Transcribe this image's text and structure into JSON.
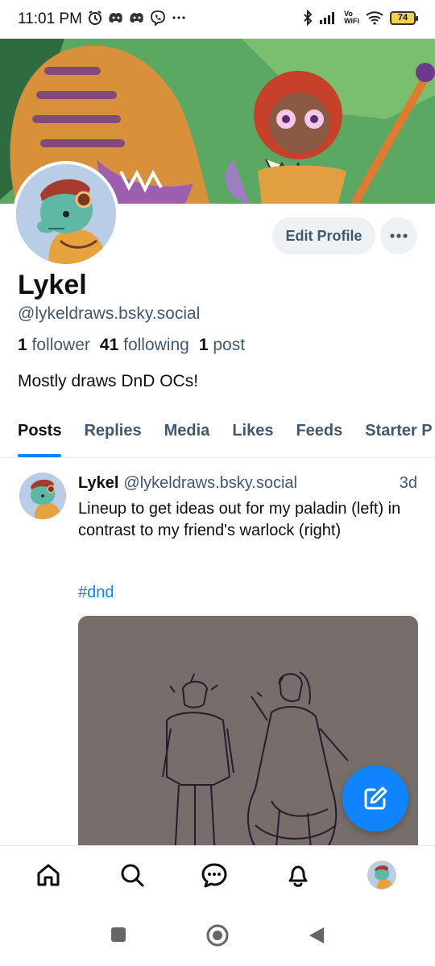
{
  "status_bar": {
    "time": "11:01 PM",
    "left_icons": [
      "alarm-icon",
      "discord-icon",
      "discord-icon",
      "viber-icon",
      "more-dots-icon"
    ],
    "right_icons": [
      "bluetooth-icon",
      "signal-icon",
      "vowifi-icon",
      "wifi-icon",
      "battery-icon"
    ],
    "vowifi": "Vo\nWiFi",
    "battery": "74"
  },
  "profile": {
    "banner_icon": "banner-image",
    "avatar_icon": "avatar-image",
    "edit_button": "Edit Profile",
    "more_icon": "more-horizontal-icon",
    "display_name": "Lykel",
    "handle": "@lykeldraws.bsky.social",
    "followers_count": "1",
    "followers_label": "follower",
    "following_count": "41",
    "following_label": "following",
    "posts_count": "1",
    "posts_label": "post",
    "bio": "Mostly draws DnD OCs!"
  },
  "tabs": [
    {
      "label": "Posts",
      "active": true
    },
    {
      "label": "Replies",
      "active": false
    },
    {
      "label": "Media",
      "active": false
    },
    {
      "label": "Likes",
      "active": false
    },
    {
      "label": "Feeds",
      "active": false
    },
    {
      "label": "Starter P",
      "active": false
    }
  ],
  "post": {
    "author": "Lykel",
    "handle": "@lykeldraws.bsky.social",
    "time": "3d",
    "text": "Lineup to get ideas out for my paladin (left) in contrast to my friend's warlock (right)",
    "hashtag": "#dnd",
    "image_icon": "sketch-image"
  },
  "fab_icon": "compose-icon",
  "bottom_nav": [
    "home-icon",
    "search-icon",
    "chat-icon",
    "notifications-icon",
    "profile-avatar"
  ],
  "system_nav": [
    "recents-button",
    "home-button",
    "back-button"
  ],
  "colors": {
    "accent": "#1083fe",
    "muted_text": "#42576c",
    "button_bg": "#eef1f4"
  }
}
